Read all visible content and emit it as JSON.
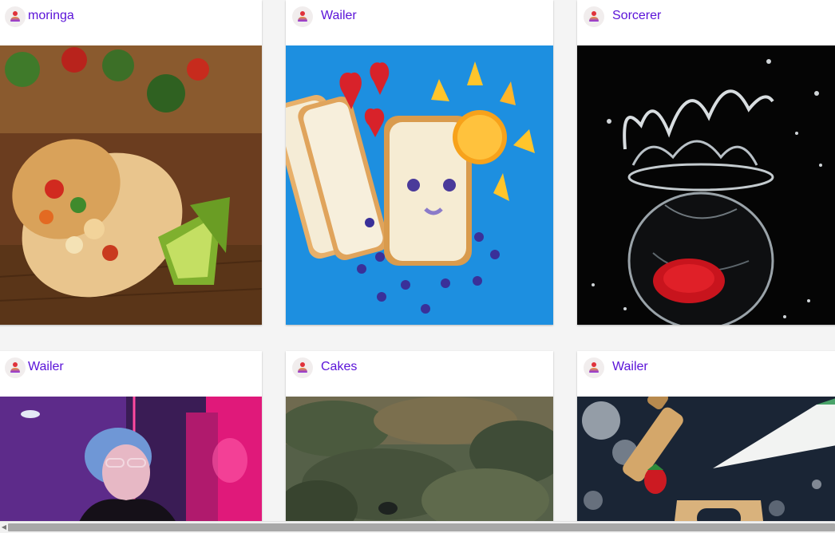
{
  "posts": [
    {
      "username": "moringa",
      "image": "burrito-photo"
    },
    {
      "username": "Wailer",
      "image": "bread-face-photo"
    },
    {
      "username": "Sorcerer",
      "image": "water-splash-glass-photo"
    },
    {
      "username": "Wailer",
      "image": "neon-portrait-photo"
    },
    {
      "username": "Cakes",
      "image": "forest-cyclist-photo"
    },
    {
      "username": "Wailer",
      "image": "baking-flour-photo"
    }
  ],
  "icons": {
    "avatar": "user-avatar-icon",
    "scroll_left": "scroll-left-arrow-icon"
  },
  "colors": {
    "username": "#5a12d8",
    "page_background": "#f4f4f4",
    "card_background": "#ffffff"
  }
}
